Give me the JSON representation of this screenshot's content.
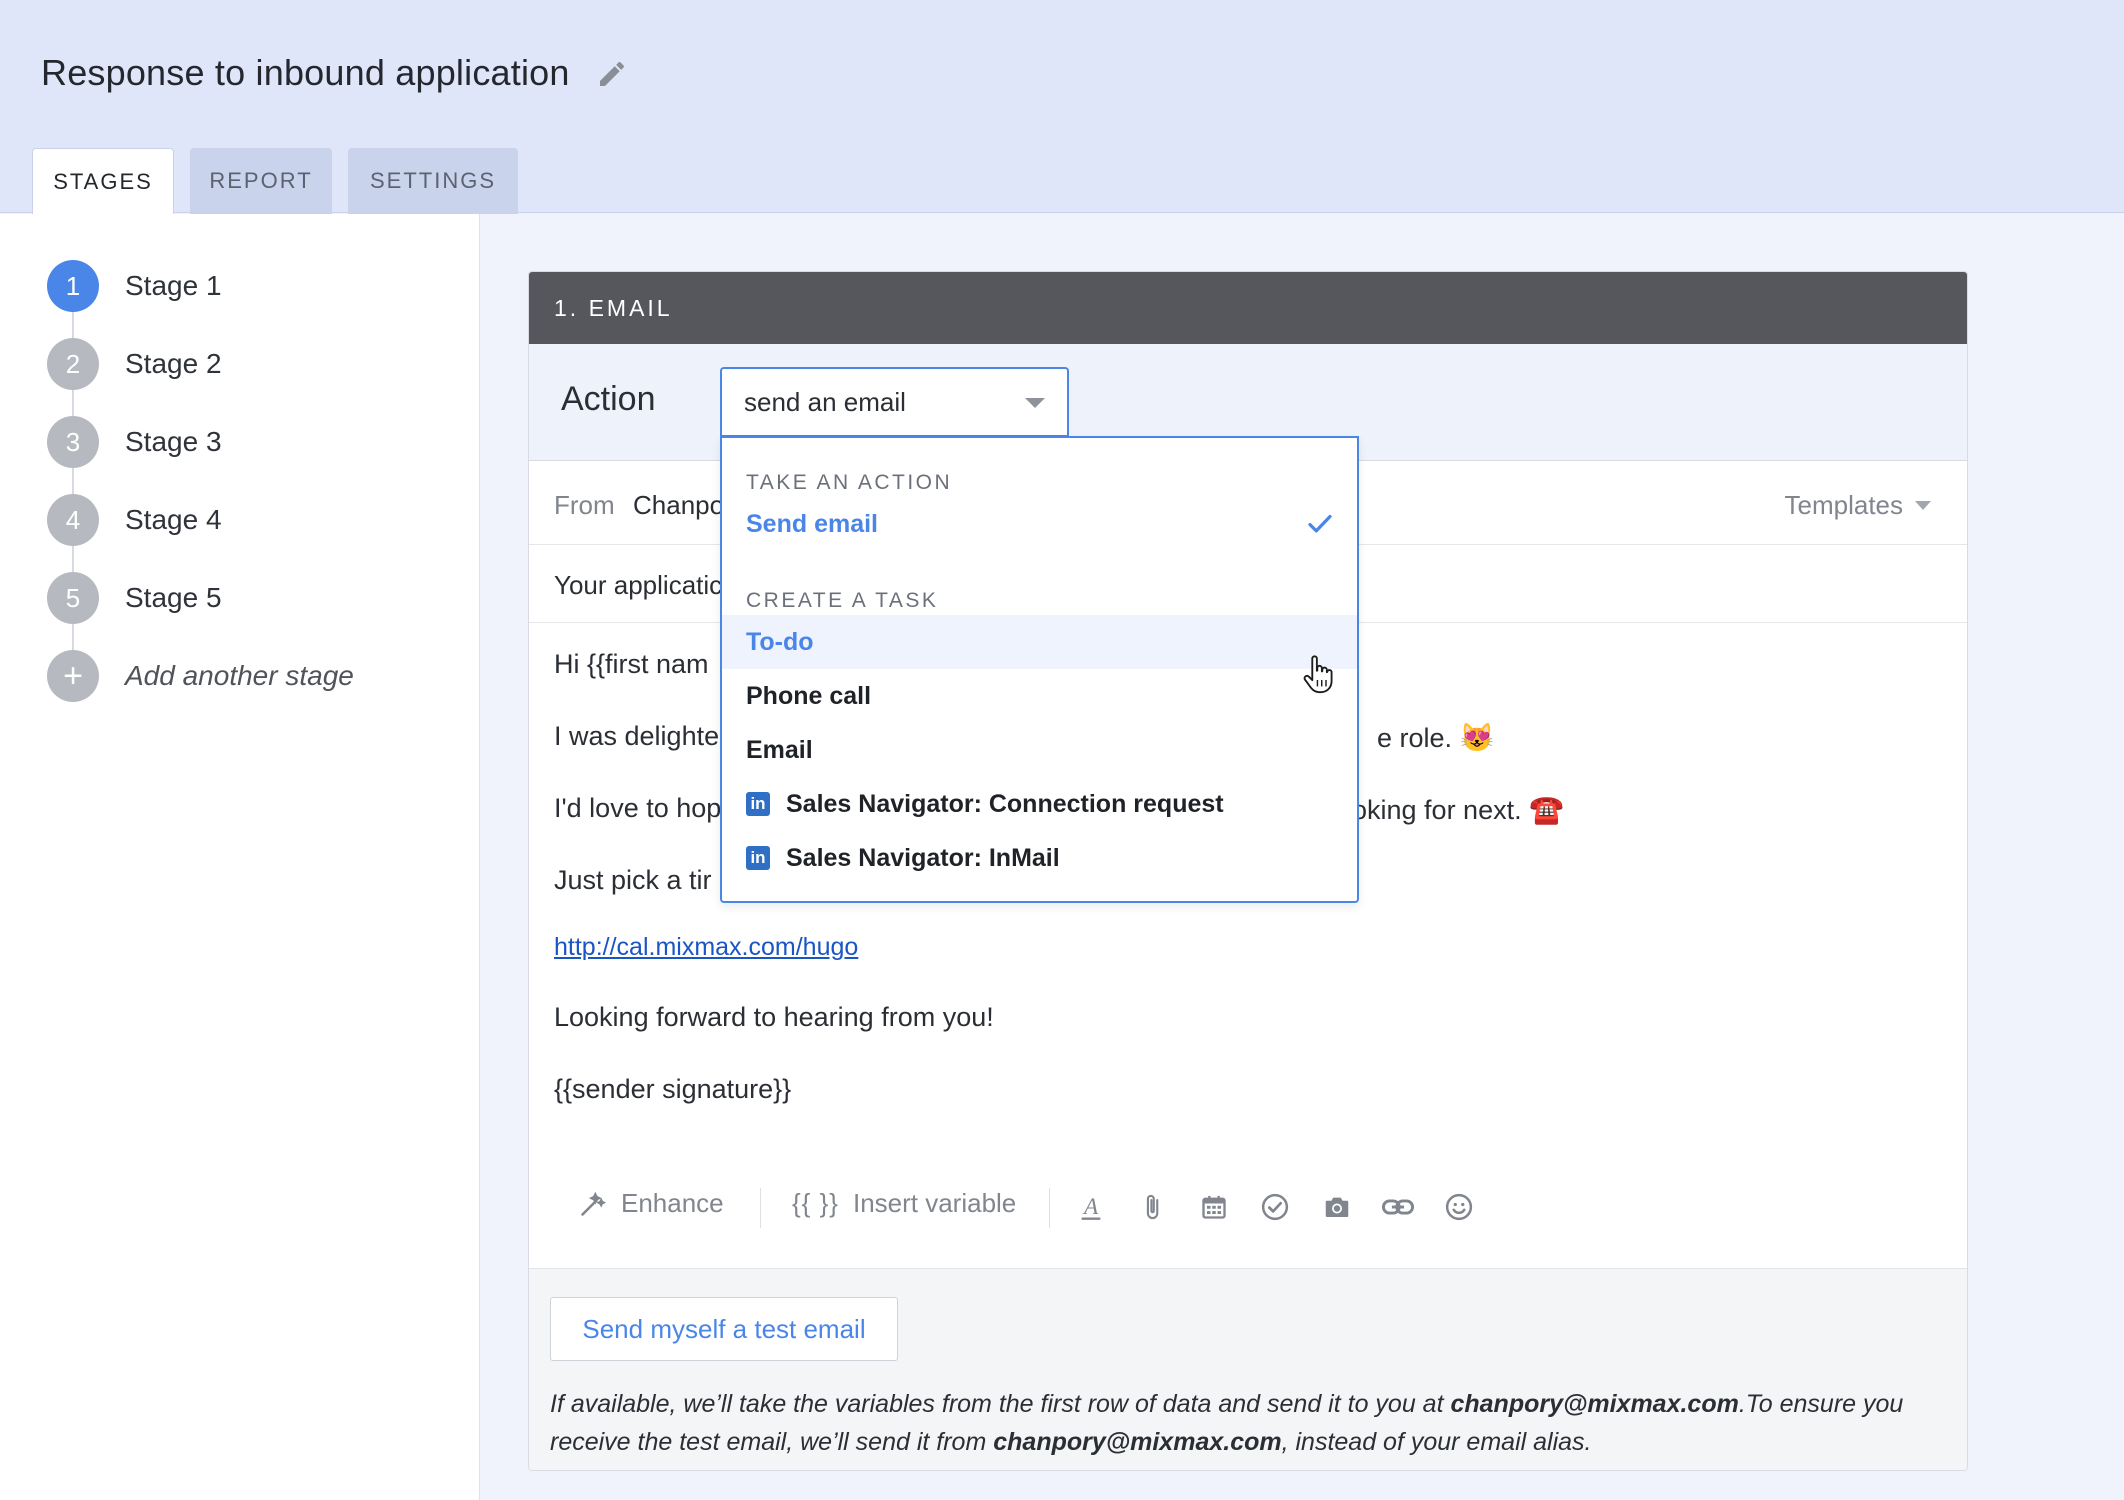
{
  "header": {
    "title": "Response to inbound application",
    "tabs": [
      {
        "label": "STAGES",
        "active": true
      },
      {
        "label": "REPORT",
        "active": false
      },
      {
        "label": "SETTINGS",
        "active": false
      }
    ]
  },
  "sidebar": {
    "stages": [
      {
        "num": "1",
        "label": "Stage 1",
        "active": true
      },
      {
        "num": "2",
        "label": "Stage 2",
        "active": false
      },
      {
        "num": "3",
        "label": "Stage 3",
        "active": false
      },
      {
        "num": "4",
        "label": "Stage 4",
        "active": false
      },
      {
        "num": "5",
        "label": "Stage 5",
        "active": false
      }
    ],
    "add_stage": {
      "icon": "+",
      "label": "Add another stage"
    }
  },
  "card": {
    "header": "1. EMAIL",
    "action_label": "Action",
    "action_value": "send an email",
    "from_label": "From",
    "from_value": "Chanpo",
    "templates_label": "Templates",
    "subject": "Your applicatic",
    "body": {
      "line1": "Hi {{first nam",
      "line2_start": "I was delighte",
      "line2_end": "e role.",
      "line2_emoji": "😻",
      "line3_start": "I'd love to hop",
      "line3_end": "oking for next.",
      "line3_emoji": "☎️",
      "line4": "Just pick a tir",
      "link": "http://cal.mixmax.com/hugo",
      "line6": "Looking forward to hearing from you!",
      "line7": "{{sender signature}}"
    },
    "toolbar": {
      "enhance_label": "Enhance",
      "variable_glyph": "{{ }}",
      "variable_label": "Insert variable",
      "icons": [
        "text-format-icon",
        "attachment-icon",
        "calendar-icon",
        "checkmark-circle-icon",
        "camera-icon",
        "link-icon",
        "smiley-icon"
      ]
    },
    "footer": {
      "test_button": "Send myself a test email",
      "note_1": "If available, we’ll take the variables from the first row of data and send it to you at ",
      "note_email_1": "chanpory@mixmax.com",
      "note_2": ".To ensure you receive the test email, we’ll send it from ",
      "note_email_2": "chanpory@mixmax.com",
      "note_3": ", instead of your email alias."
    }
  },
  "dropdown": {
    "section1": "TAKE AN ACTION",
    "section1_items": [
      {
        "label": "Send email",
        "selected": true
      }
    ],
    "section2": "CREATE A TASK",
    "section2_items": [
      {
        "label": "To-do",
        "hover": true
      },
      {
        "label": "Phone call"
      },
      {
        "label": "Email"
      },
      {
        "label": "Sales Navigator: Connection request",
        "icon": "linkedin-icon"
      },
      {
        "label": "Sales Navigator: InMail",
        "icon": "linkedin-icon"
      }
    ],
    "linkedin_glyph": "in"
  },
  "colors": {
    "accent": "#4a86e8",
    "header_bg": "#dfe6f9",
    "card_header": "#55575d",
    "link": "#1a55c4"
  }
}
